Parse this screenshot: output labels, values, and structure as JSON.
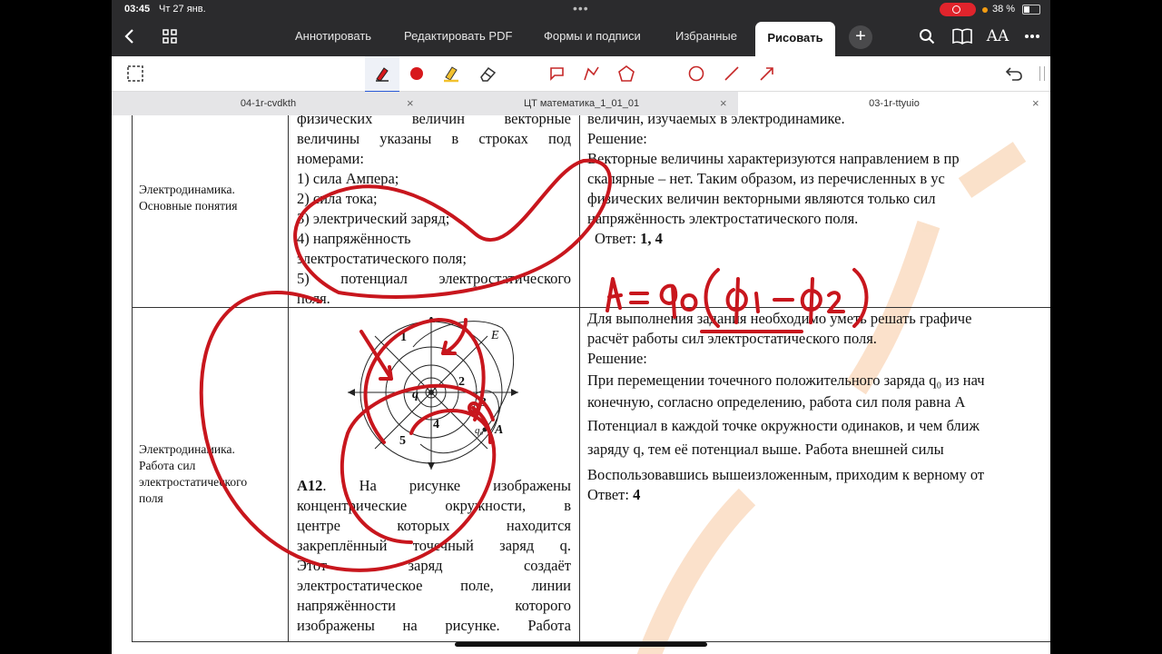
{
  "status": {
    "time": "03:45",
    "date": "Чт 27 янв.",
    "battery": "38 %"
  },
  "nav": {
    "items": [
      "Аннотировать",
      "Редактировать PDF",
      "Формы и подписи",
      "Избранные"
    ],
    "active": "Рисовать",
    "icons": [
      "back-icon",
      "grid-icon",
      "plus-icon",
      "search-icon",
      "book-icon",
      "text-size-icon",
      "more-icon"
    ],
    "text_size_label": "AA"
  },
  "tools": {
    "left": [
      "lasso-select-icon"
    ],
    "drawing": [
      "pen-icon",
      "color-dot-icon",
      "highlighter-icon",
      "eraser-icon"
    ],
    "shapes": [
      "callout-icon",
      "polyline-icon",
      "polygon-icon",
      "circle-icon",
      "line-icon",
      "arrow-icon"
    ],
    "right": [
      "undo-icon"
    ],
    "pen_color": "#d7191c"
  },
  "tabs": [
    {
      "label": "04-1r-cvdkth",
      "active": false
    },
    {
      "label": "ЦТ математика_1_01_01",
      "active": false
    },
    {
      "label": "03-1r-ttyuio",
      "active": true
    }
  ],
  "doc": {
    "row1": {
      "topic": [
        "Электродинамика.",
        "Основные понятия"
      ],
      "question": [
        "физических величин векторные",
        "величины указаны в строках под",
        "номерами:",
        "1) сила Ампера;",
        "2) сила тока;",
        "3) электрический заряд;",
        "4) напряжённость",
        "электростатического поля;",
        "5) потенциал электростатического",
        "поля."
      ],
      "answer": [
        "величин, изучаемых в электродинамике.",
        "Решение:",
        "Векторные величины характеризуются направлением в пр",
        "скалярные – нет. Таким образом, из перечисленных в ус",
        "физических величин векторными являются только сил",
        "напряжённость электростатического поля."
      ],
      "answer_label": "Ответ:",
      "answer_value": "1, 4"
    },
    "row2": {
      "topic": [
        "Электродинамика.",
        "Работа сил",
        "электростатического",
        "поля"
      ],
      "figure_labels": {
        "n1": "1",
        "n2": "2",
        "n3": "3",
        "n4": "4",
        "n5": "5",
        "q": "q",
        "E": "E",
        "A": "A",
        "q0": "q₀"
      },
      "task_num": "А12",
      "question": [
        ". На рисунке изображены",
        "концентрические окружности, в",
        "центре которых находится",
        "закреплённый точечный заряд q.",
        "Этот заряд создаёт",
        "электростатическое поле, линии",
        "напряжённости которого",
        "изображены на рисунке. Работа"
      ],
      "solution": [
        "Для выполнения задания необходимо уметь решать графиче",
        "расчёт работы сил электростатического поля.",
        "Решение:",
        "При перемещении точечного положительного заряда q₀ из нач",
        "конечную, согласно определению, работа сил поля равна A",
        "Потенциал в каждой точке окружности одинаков, и чем ближ",
        "заряду q, тем её потенциал выше. Работа внешней силы",
        "Воспользовавшись вышеизложенным, приходим к верному от"
      ],
      "answer_label": "Ответ:",
      "answer_value": "4"
    },
    "handwriting": "A = q₀(φ₁ − φ₂)",
    "ink_color": "#c8161d"
  }
}
